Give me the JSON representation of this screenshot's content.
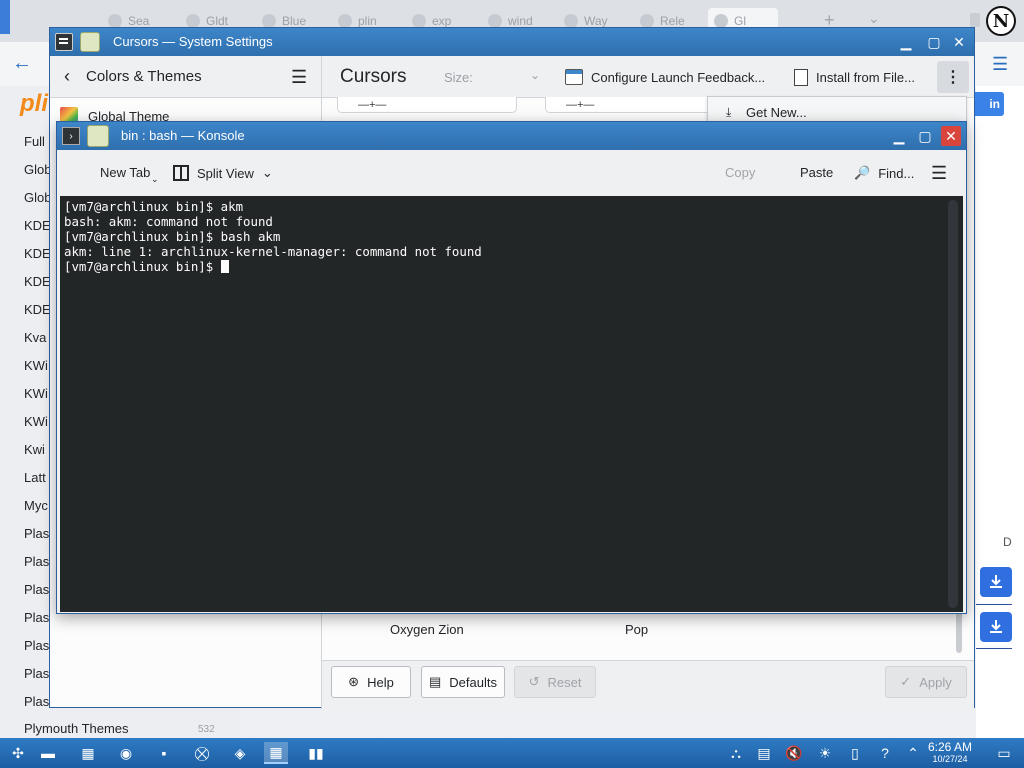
{
  "browser": {
    "tabs": [
      {
        "label": "Sea"
      },
      {
        "label": "Gldt"
      },
      {
        "label": "Blue"
      },
      {
        "label": "plin"
      },
      {
        "label": "exp"
      },
      {
        "label": "wind"
      },
      {
        "label": "Way"
      },
      {
        "label": "Rele"
      },
      {
        "label": "Gl"
      }
    ],
    "profile_initial": "N",
    "logo": "pli",
    "sidebar_items": [
      "Full",
      "Glob",
      "Glob",
      "KDE",
      "KDE",
      "KDE",
      "KDE",
      "Kva",
      "KWi",
      "KWi",
      "KWi",
      "Kwi",
      "Latt",
      "Myc",
      "Plas",
      "Plas",
      "Plas",
      "Plas",
      "Plas",
      "Plas",
      "Plas"
    ],
    "plymouth_label": "Plymouth Themes",
    "plymouth_count": "532",
    "login_label": "in",
    "side_letter": "D"
  },
  "settings": {
    "title": "Cursors — System Settings",
    "section": "Colors & Themes",
    "global_theme": "Global Theme",
    "page_title": "Cursors",
    "size_label": "Size:",
    "launch_feedback": "Configure Launch Feedback...",
    "install_from_file": "Install from File...",
    "get_new": "Get New...",
    "themes": [
      "Oxygen Zion",
      "Pop"
    ],
    "buttons": {
      "help": "Help",
      "defaults": "Defaults",
      "reset": "Reset",
      "apply": "Apply"
    }
  },
  "konsole": {
    "title": "bin : bash — Konsole",
    "toolbar": {
      "new_tab": "New Tab",
      "split_view": "Split View",
      "copy": "Copy",
      "paste": "Paste",
      "find": "Find..."
    },
    "lines": [
      "[vm7@archlinux bin]$ akm",
      "bash: akm: command not found",
      "[vm7@archlinux bin]$ bash akm",
      "akm: line 1: archlinux-kernel-manager: command not found",
      "[vm7@archlinux bin]$ "
    ]
  },
  "taskbar": {
    "time": "6:26 AM",
    "date": "10/27/24"
  },
  "colors": {
    "titlebar": "#3d86c9",
    "terminal_bg": "#232627",
    "taskbar": "#2f7bc4",
    "close_red": "#d9453d"
  }
}
